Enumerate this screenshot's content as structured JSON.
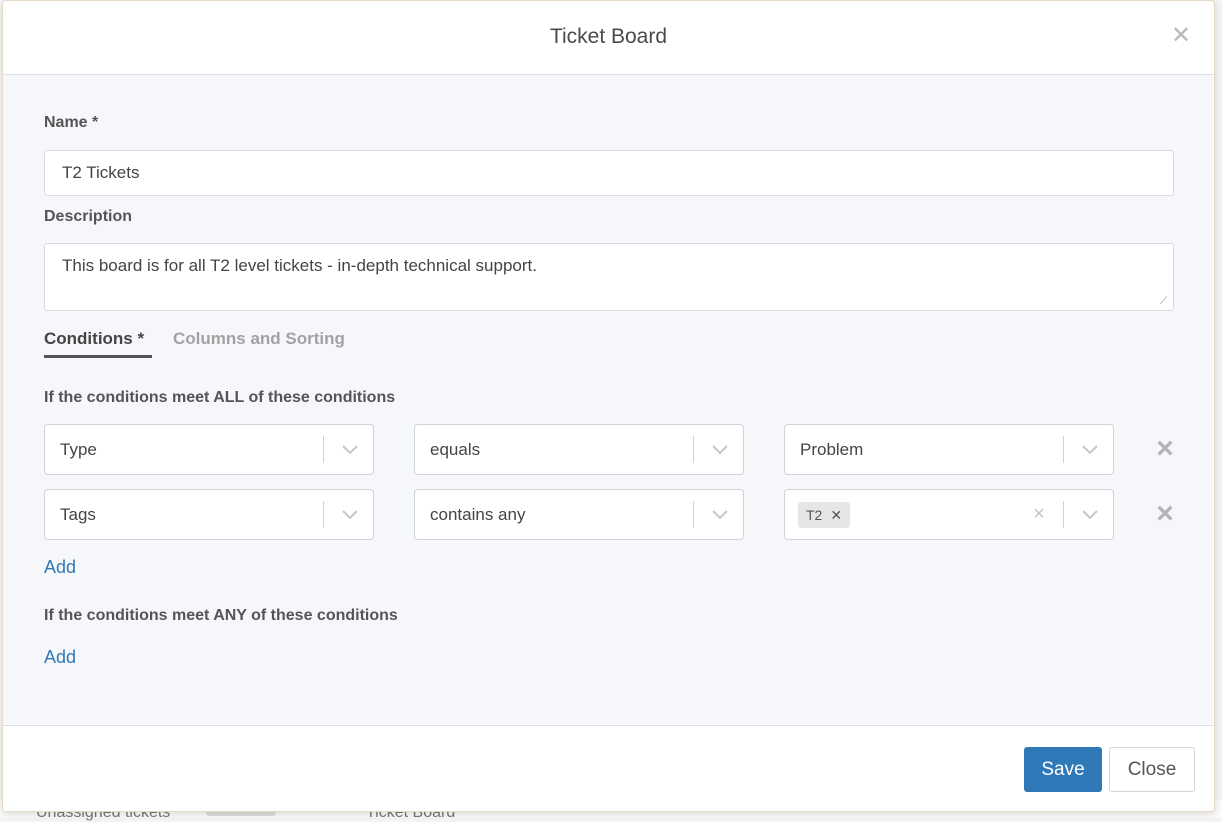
{
  "background": {
    "row_texts": [
      "Unassigned tickets",
      "Ticket Board"
    ]
  },
  "modal": {
    "title": "Ticket Board",
    "close_icon": "close-icon"
  },
  "form": {
    "name_label": "Name *",
    "name_value": "T2 Tickets",
    "description_label": "Description",
    "description_value": "This board is for all T2 level tickets - in-depth technical support."
  },
  "tabs": [
    {
      "label": "Conditions *",
      "active": true
    },
    {
      "label": "Columns and Sorting",
      "active": false
    }
  ],
  "all_conditions": {
    "heading": "If the conditions meet ALL of these conditions",
    "rows": [
      {
        "field": "Type",
        "operator": "equals",
        "value": "Problem"
      },
      {
        "field": "Tags",
        "operator": "contains any",
        "tags": [
          "T2"
        ]
      }
    ],
    "add_label": "Add"
  },
  "any_conditions": {
    "heading": "If the conditions meet ANY of these conditions",
    "add_label": "Add"
  },
  "footer": {
    "save_label": "Save",
    "close_label": "Close"
  },
  "colors": {
    "primary": "#2f79b9",
    "link": "#3277b5",
    "body_background": "#f5f7fb"
  }
}
